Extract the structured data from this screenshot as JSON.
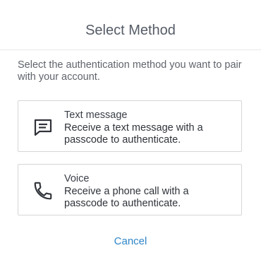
{
  "dialog": {
    "title": "Select Method",
    "instructions": "Select the authentication method you want to pair with your account.",
    "options": [
      {
        "icon": "message-icon",
        "label": "Text message",
        "description": "Receive a text message with a passcode to authenticate."
      },
      {
        "icon": "phone-icon",
        "label": "Voice",
        "description": "Receive a phone call with a passcode to authenticate."
      }
    ],
    "cancel_label": "Cancel"
  },
  "colors": {
    "link": "#2f86c8",
    "border": "#d6d6d6",
    "title": "#555b66"
  }
}
